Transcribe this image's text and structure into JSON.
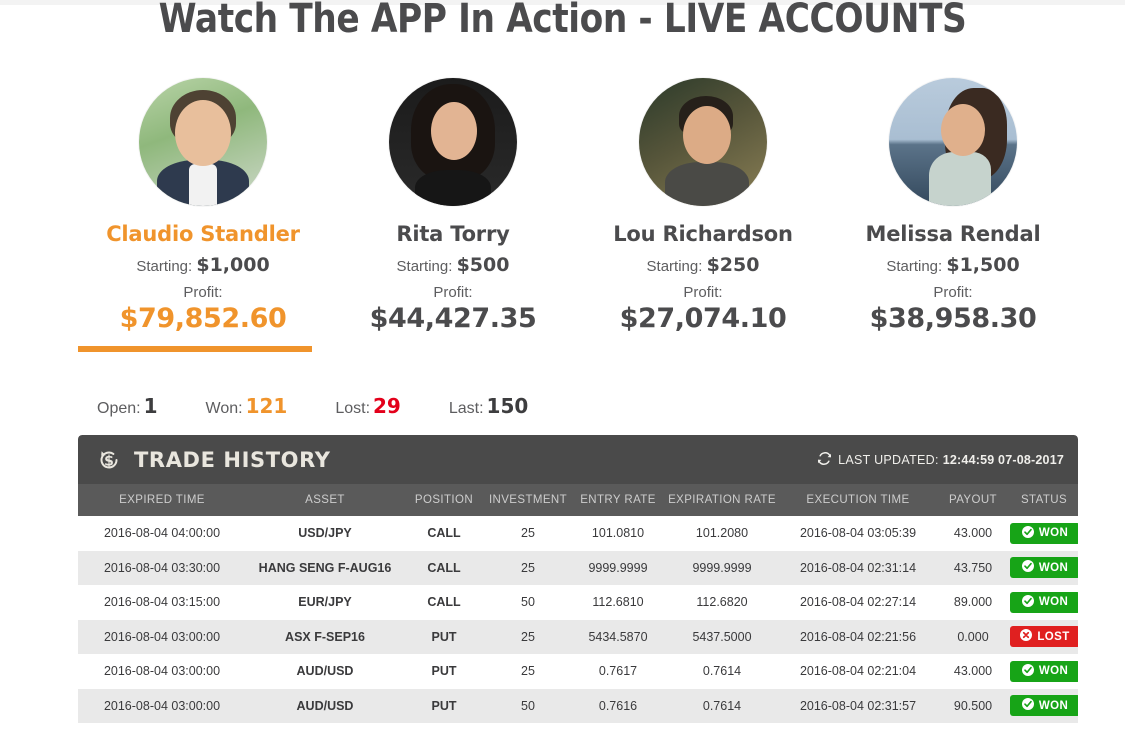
{
  "page_title": "Watch The APP In Action - LIVE ACCOUNTS",
  "colors": {
    "accent_orange": "#f0942c",
    "dark_text": "#4b4b4d",
    "win_green": "#17a417",
    "lost_red": "#e02020",
    "panel_dark": "#4a4a4a",
    "table_header": "#5a5a5a"
  },
  "traders": [
    {
      "name": "Claudio Standler",
      "starting_label": "Starting:",
      "starting_value": "$1,000",
      "profit_label": "Profit:",
      "profit_value": "$79,852.60",
      "active": true,
      "avatar": "avatar-claudio-standler"
    },
    {
      "name": "Rita Torry",
      "starting_label": "Starting:",
      "starting_value": "$500",
      "profit_label": "Profit:",
      "profit_value": "$44,427.35",
      "active": false,
      "avatar": "avatar-rita-torry"
    },
    {
      "name": "Lou Richardson",
      "starting_label": "Starting:",
      "starting_value": "$250",
      "profit_label": "Profit:",
      "profit_value": "$27,074.10",
      "active": false,
      "avatar": "avatar-lou-richardson"
    },
    {
      "name": "Melissa Rendal",
      "starting_label": "Starting:",
      "starting_value": "$1,500",
      "profit_label": "Profit:",
      "profit_value": "$38,958.30",
      "active": false,
      "avatar": "avatar-melissa-rendal"
    }
  ],
  "stats": [
    {
      "label": "Open:",
      "value": "1",
      "tone": "dark"
    },
    {
      "label": "Won:",
      "value": "121",
      "tone": "orange"
    },
    {
      "label": "Lost:",
      "value": "29",
      "tone": "red"
    },
    {
      "label": "Last:",
      "value": "150",
      "tone": "dark"
    }
  ],
  "panel": {
    "icon": "refresh-dollar-icon",
    "title": "TRADE HISTORY",
    "updated_icon": "refresh-icon",
    "updated_label": "LAST UPDATED:",
    "updated_value": "12:44:59 07-08-2017"
  },
  "table": {
    "columns": [
      "EXPIRED TIME",
      "ASSET",
      "POSITION",
      "INVESTMENT",
      "ENTRY RATE",
      "EXPIRATION RATE",
      "EXECUTION TIME",
      "PAYOUT",
      "STATUS"
    ],
    "rows": [
      {
        "expired_time": "2016-08-04 04:00:00",
        "asset": "USD/JPY",
        "position": "CALL",
        "investment": "25",
        "entry_rate": "101.0810",
        "expiration_rate": "101.2080",
        "execution_time": "2016-08-04 03:05:39",
        "payout": "43.000",
        "status": "WON"
      },
      {
        "expired_time": "2016-08-04 03:30:00",
        "asset": "HANG SENG F-AUG16",
        "position": "CALL",
        "investment": "25",
        "entry_rate": "9999.9999",
        "expiration_rate": "9999.9999",
        "execution_time": "2016-08-04 02:31:14",
        "payout": "43.750",
        "status": "WON"
      },
      {
        "expired_time": "2016-08-04 03:15:00",
        "asset": "EUR/JPY",
        "position": "CALL",
        "investment": "50",
        "entry_rate": "112.6810",
        "expiration_rate": "112.6820",
        "execution_time": "2016-08-04 02:27:14",
        "payout": "89.000",
        "status": "WON"
      },
      {
        "expired_time": "2016-08-04 03:00:00",
        "asset": "ASX F-SEP16",
        "position": "PUT",
        "investment": "25",
        "entry_rate": "5434.5870",
        "expiration_rate": "5437.5000",
        "execution_time": "2016-08-04 02:21:56",
        "payout": "0.000",
        "status": "LOST"
      },
      {
        "expired_time": "2016-08-04 03:00:00",
        "asset": "AUD/USD",
        "position": "PUT",
        "investment": "25",
        "entry_rate": "0.7617",
        "expiration_rate": "0.7614",
        "execution_time": "2016-08-04 02:21:04",
        "payout": "43.000",
        "status": "WON"
      },
      {
        "expired_time": "2016-08-04 03:00:00",
        "asset": "AUD/USD",
        "position": "PUT",
        "investment": "50",
        "entry_rate": "0.7616",
        "expiration_rate": "0.7614",
        "execution_time": "2016-08-04 02:31:57",
        "payout": "90.500",
        "status": "WON"
      }
    ]
  }
}
